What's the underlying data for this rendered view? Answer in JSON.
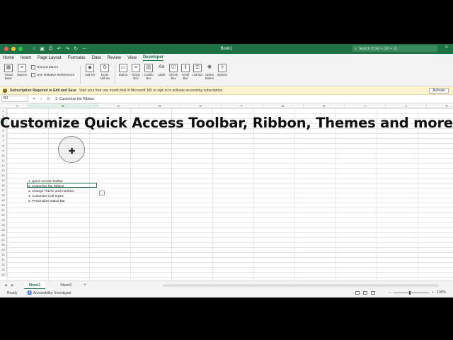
{
  "window": {
    "title": "Book1",
    "search_placeholder": "Search (Cmd + Ctrl + U)"
  },
  "tabs": [
    "Home",
    "Insert",
    "Page Layout",
    "Formulas",
    "Data",
    "Review",
    "View",
    "Developer"
  ],
  "active_tab": "Developer",
  "ribbon": {
    "visual_basic": "Visual Basic",
    "macros": "Macros",
    "record_macro": "Record Macro",
    "use_relative": "Use Relative References",
    "add_ins": "Add-ins",
    "excel_add_ins": "Excel Add-ins",
    "button": "Button",
    "group_box": "Group Box",
    "combo_box": "Combo Box",
    "label": "Label",
    "check_box": "Check Box",
    "scroll_bar": "Scroll Bar",
    "list_box": "List Box",
    "option_button": "Option Button",
    "spinner": "Spinner"
  },
  "subscription": {
    "title": "Subscription Required to Edit and Save",
    "message": "Start your free one month trial of Microsoft 365 or sign in to activate an existing subscription.",
    "activate": "Activate"
  },
  "formula_bar": {
    "name_box": "B3",
    "fx": "fx",
    "formula": "2. Customize the Ribbon"
  },
  "columns": [
    "A",
    "B",
    "C",
    "D",
    "E",
    "F",
    "G",
    "H",
    "I",
    "J",
    "K",
    "L",
    "M",
    "N"
  ],
  "rows": [
    "1",
    "2",
    "3",
    "4",
    "5",
    "6",
    "7",
    "8",
    "9",
    "10",
    "11",
    "12",
    "13",
    "14",
    "15",
    "16",
    "17",
    "18",
    "19",
    "20",
    "21",
    "22",
    "23",
    "24",
    "25",
    "26",
    "27",
    "28",
    "29",
    "30",
    "31",
    "32",
    "33",
    "34"
  ],
  "cells": {
    "b2": "1. Quick Access Toolbar",
    "b3": "2. Customize the Ribbon",
    "b4": "3. Change Theme and Interface",
    "b5": "4. Customize Cell Styles",
    "b6": "5. Personalize Status Bar"
  },
  "overlay_title": "Customize Quick Access Toolbar, Ribbon, Themes and more",
  "sheets": [
    "Sheet1",
    "Sheet3"
  ],
  "active_sheet": "Sheet1",
  "status": {
    "ready": "Ready",
    "accessibility": "Accessibility: Investigate",
    "zoom": "100%"
  },
  "colors": {
    "accent": "#1e7145",
    "subscription_bg": "#fff4ce"
  }
}
